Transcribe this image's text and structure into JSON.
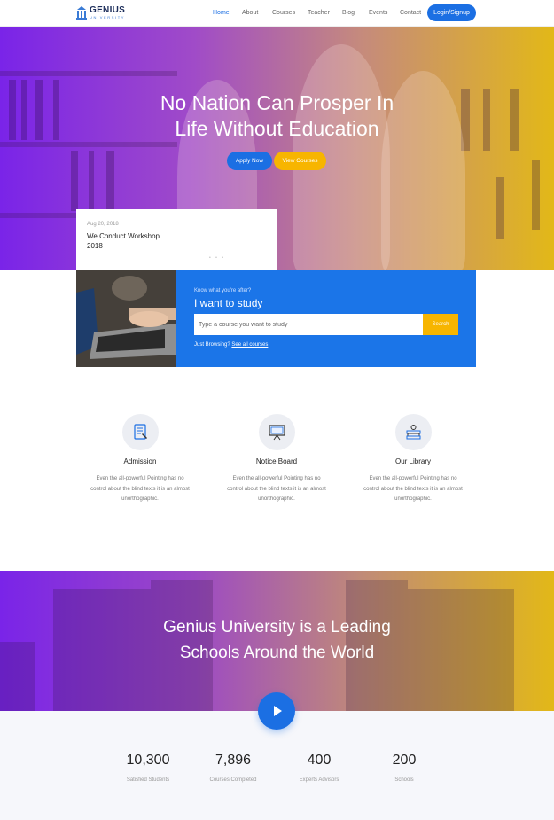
{
  "brand": {
    "name": "GENIUS",
    "sub": "UNIVERSITY"
  },
  "nav": {
    "items": [
      "Home",
      "About",
      "Courses",
      "Teacher",
      "Blog",
      "Events",
      "Contact"
    ],
    "login": "Login/Signup"
  },
  "hero": {
    "title_line1": "No Nation Can Prosper In",
    "title_line2": "Life Without Education",
    "apply": "Apply Now",
    "view": "View Courses"
  },
  "news": {
    "date": "Aug 20, 2018",
    "title": "We Conduct Workshop 2018"
  },
  "study": {
    "kicker": "Know what you're after?",
    "title": "I want to study",
    "placeholder": "Type a course you want to study",
    "search": "Search",
    "browse_prefix": "Just Browsing?",
    "browse_link": "See all courses"
  },
  "features": [
    {
      "icon": "document-icon",
      "title": "Admission",
      "desc": "Even the all-powerful Pointing has no control about the blind texts it is an almost unorthographic."
    },
    {
      "icon": "board-icon",
      "title": "Notice Board",
      "desc": "Even the all-powerful Pointing has no control about the blind texts it is an almost unorthographic."
    },
    {
      "icon": "library-icon",
      "title": "Our Library",
      "desc": "Even the all-powerful Pointing has no control about the blind texts it is an almost unorthographic."
    }
  ],
  "banner": {
    "line1": "Genius University is a Leading",
    "line2": "Schools Around the World"
  },
  "stats": [
    {
      "value": "10,300",
      "label": "Satisfied Students"
    },
    {
      "value": "7,896",
      "label": "Courses Completed"
    },
    {
      "value": "400",
      "label": "Experts Advisors"
    },
    {
      "value": "200",
      "label": "Schools"
    }
  ],
  "colors": {
    "primary": "#1b6fe3",
    "accent": "#f7b500",
    "gradient_start": "#7a24e8",
    "gradient_end": "#e2b818"
  }
}
